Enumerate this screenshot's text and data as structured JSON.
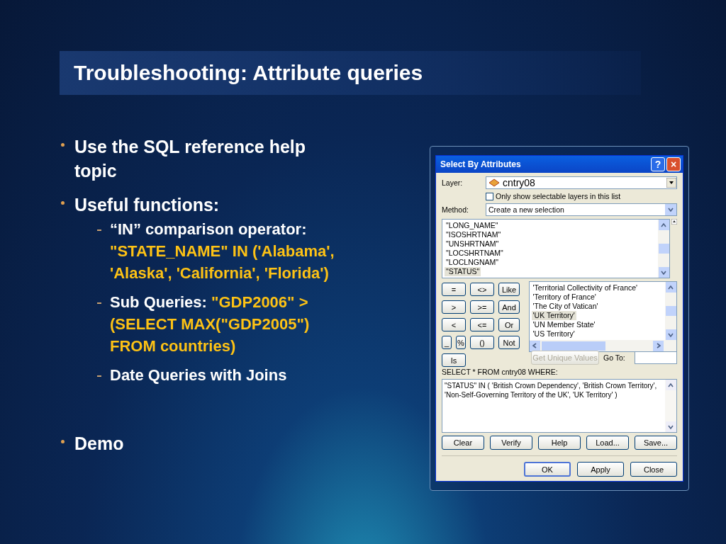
{
  "slide": {
    "title": "Troubleshooting: Attribute queries",
    "bullets": [
      {
        "parts": [
          {
            "text": "Use the SQL reference help topic",
            "highlight": false
          }
        ]
      },
      {
        "parts": [
          {
            "text": "Useful functions:",
            "highlight": false
          }
        ],
        "children": [
          {
            "parts": [
              {
                "text": "“IN” comparison operator: ",
                "highlight": false
              },
              {
                "text": "\"STATE_NAME\" IN ('Alabama', 'Alaska', 'California', 'Florida')",
                "highlight": true
              }
            ]
          },
          {
            "parts": [
              {
                "text": "Sub Queries: ",
                "highlight": false
              },
              {
                "text": "\"GDP2006\" > (SELECT MAX(\"GDP2005\") FROM countries)",
                "highlight": true
              }
            ]
          },
          {
            "parts": [
              {
                "text": "Date Queries with Joins",
                "highlight": false
              }
            ]
          }
        ]
      },
      {
        "parts": [
          {
            "text": "Demo",
            "highlight": false
          }
        ]
      }
    ]
  },
  "dialog": {
    "title": "Select By Attributes",
    "help": "?",
    "close": "×",
    "layer_label": "Layer:",
    "layer_value": "cntry08",
    "selectable_only": {
      "label": "Only show selectable layers in this list",
      "checked": false
    },
    "method_label": "Method:",
    "method_value": "Create a new selection",
    "fields": [
      {
        "text": "\"LONG_NAME\"",
        "selected": false
      },
      {
        "text": "\"ISOSHRTNAM\"",
        "selected": false
      },
      {
        "text": "\"UNSHRTNAM\"",
        "selected": false
      },
      {
        "text": "\"LOCSHRTNAM\"",
        "selected": false
      },
      {
        "text": "\"LOCLNGNAM\"",
        "selected": false
      },
      {
        "text": "\"STATUS\"",
        "selected": true
      }
    ],
    "operators": [
      [
        "=",
        "<>",
        "Like"
      ],
      [
        ">",
        ">=",
        "And"
      ],
      [
        "<",
        "<=",
        "Or"
      ],
      [
        "_",
        "%",
        "()",
        "Not"
      ]
    ],
    "is_button": "Is",
    "values": [
      {
        "text": "'Territorial Collectivity of France'",
        "selected": false
      },
      {
        "text": "'Territory of France'",
        "selected": false
      },
      {
        "text": "'The City of Vatican'",
        "selected": false
      },
      {
        "text": "'UK Territory'",
        "selected": true
      },
      {
        "text": "'UN Member State'",
        "selected": false
      },
      {
        "text": "'US Territory'",
        "selected": false
      }
    ],
    "unique_button": {
      "label": "Get Unique Values",
      "disabled": true
    },
    "goto_label": "Go To:",
    "sql_label": "SELECT * FROM cntry08 WHERE:",
    "expression": "\"STATUS\" IN ( 'British Crown Dependency', 'British Crown Territory', 'Non-Self-Governing Territory of the UK', 'UK Territory' )",
    "expression_buttons": [
      "Clear",
      "Verify",
      "Help",
      "Load...",
      "Save..."
    ],
    "footer_buttons": [
      {
        "label": "OK",
        "default": true
      },
      {
        "label": "Apply",
        "default": false
      },
      {
        "label": "Close",
        "default": false
      }
    ]
  }
}
